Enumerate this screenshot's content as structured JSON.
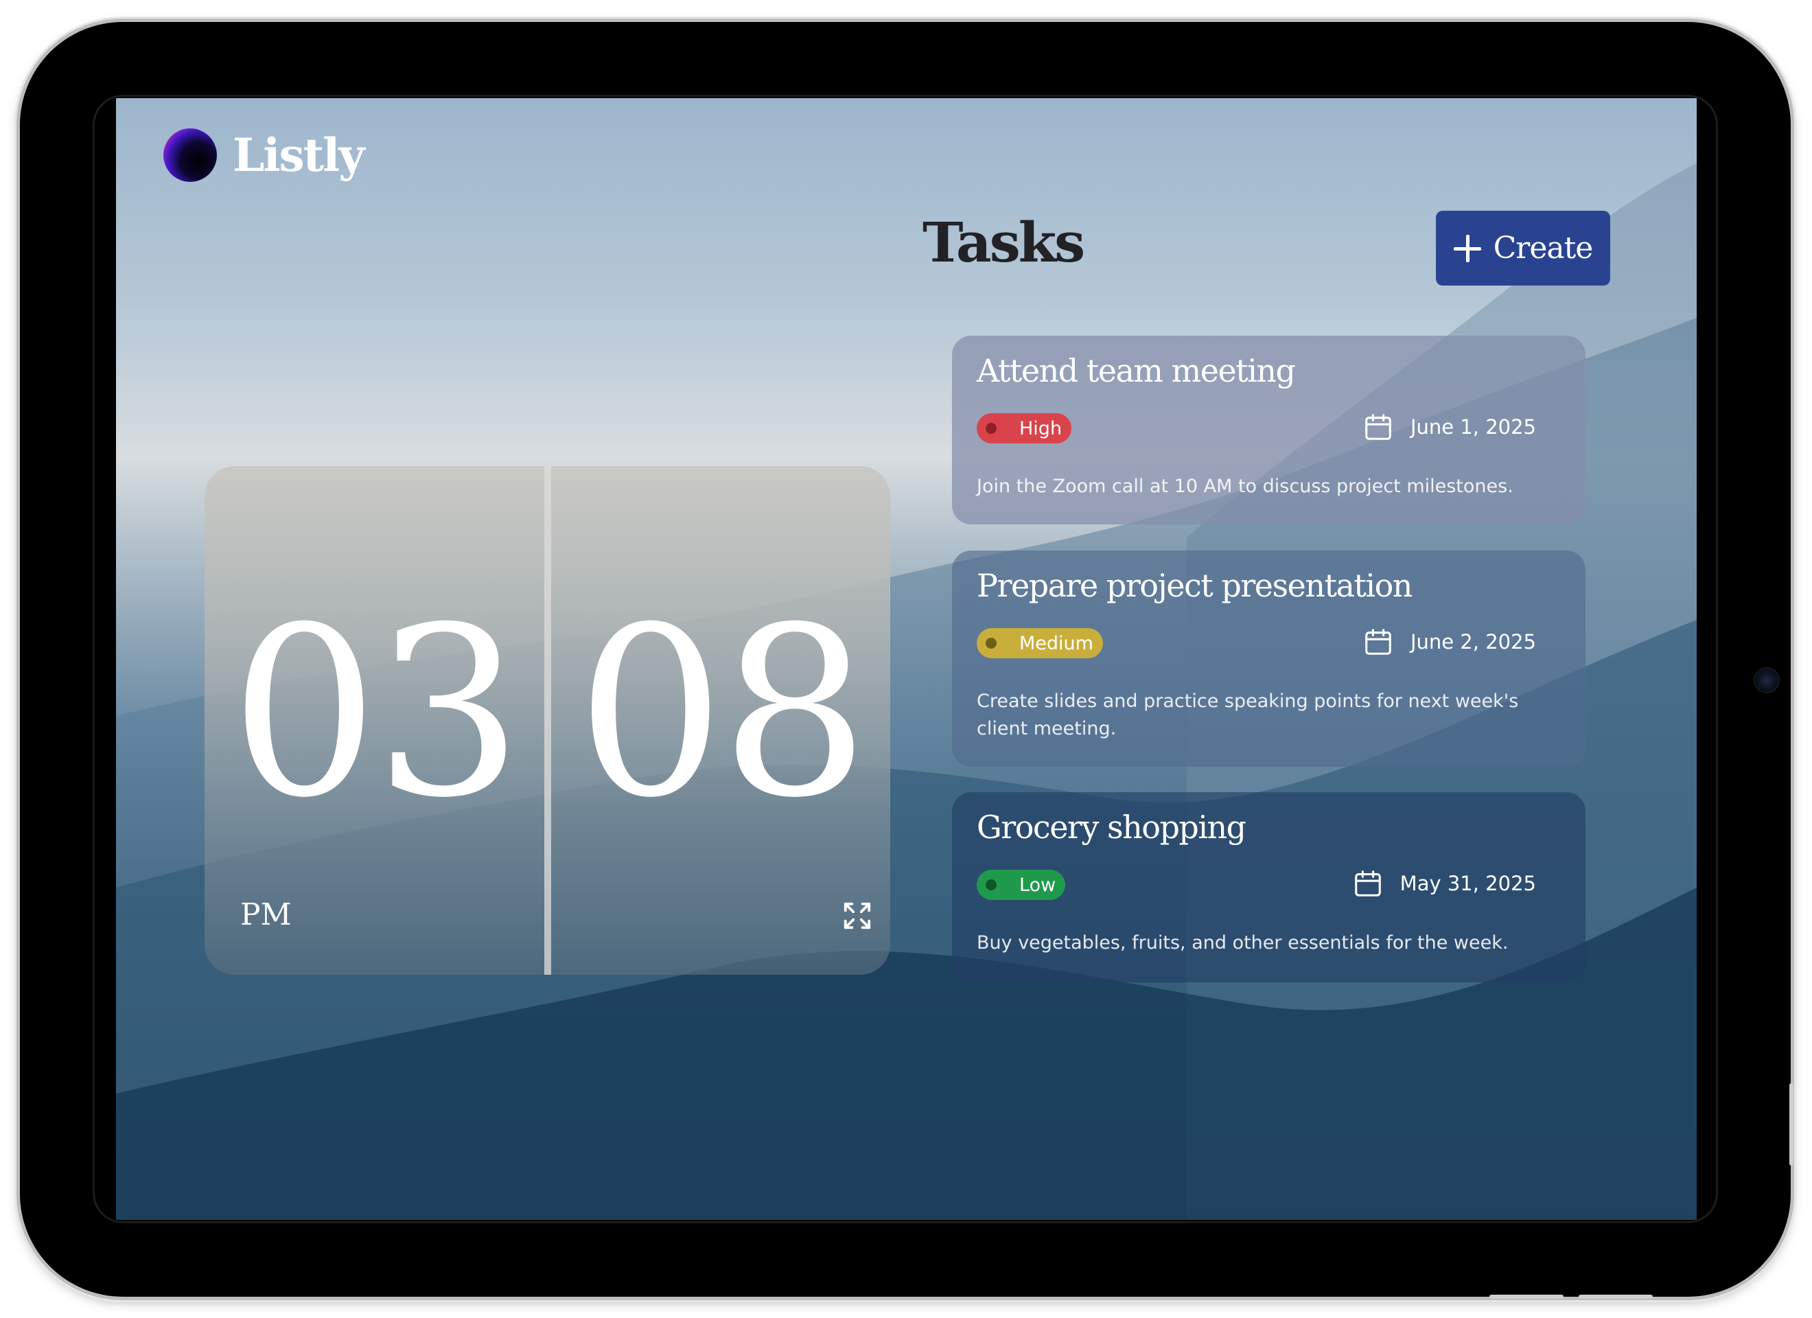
{
  "app": {
    "name": "Listly"
  },
  "header": {
    "title": "Tasks",
    "create_label": "Create"
  },
  "clock": {
    "hours": "03",
    "minutes": "08",
    "period": "PM"
  },
  "tasks": [
    {
      "title": "Attend team meeting",
      "priority": "High",
      "date": "June 1, 2025",
      "description": "Join the Zoom call at 10 AM to discuss project milestones."
    },
    {
      "title": "Prepare project presentation",
      "priority": "Medium",
      "date": "June 2, 2025",
      "description": "Create slides and practice speaking points for next week's client meeting."
    },
    {
      "title": "Grocery shopping",
      "priority": "Low",
      "date": "May 31, 2025",
      "description": "Buy vegetables, fruits, and other essentials for the week."
    }
  ],
  "colors": {
    "accent": "#2a4391",
    "priority_high": "#d9434c",
    "priority_medium": "#c9ae3c",
    "priority_low": "#1f9a4c"
  },
  "icons": {
    "logo": "gradient-orb-icon",
    "create": "plus-icon",
    "expand": "expand-icon",
    "date": "calendar-icon"
  }
}
